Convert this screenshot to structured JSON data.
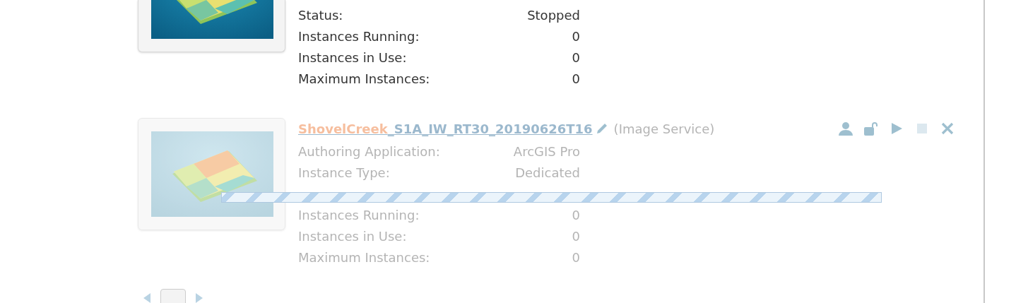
{
  "services": [
    {
      "partial": true,
      "busy": false,
      "details": [
        {
          "kind": "field",
          "label": "Status:",
          "value": "Stopped"
        },
        {
          "kind": "field",
          "label": "Instances Running:",
          "value": "0"
        },
        {
          "kind": "field",
          "label": "Instances in Use:",
          "value": "0"
        },
        {
          "kind": "field",
          "label": "Maximum Instances:",
          "value": "0"
        }
      ]
    },
    {
      "partial": false,
      "busy": true,
      "title": {
        "match": "ShovelCreek",
        "rest": "_S1A_IW_RT30_20190626T16"
      },
      "type": "(Image Service)",
      "actions": [
        {
          "kind": "person",
          "disabled": false
        },
        {
          "kind": "unlock",
          "disabled": false
        },
        {
          "kind": "play",
          "disabled": false
        },
        {
          "kind": "stop",
          "disabled": true
        },
        {
          "kind": "close",
          "disabled": false
        }
      ],
      "details": [
        {
          "kind": "field",
          "label": "Authoring Application:",
          "value": "ArcGIS Pro"
        },
        {
          "kind": "field",
          "label": "Instance Type:",
          "value": "Dedicated"
        },
        {
          "kind": "progress"
        },
        {
          "kind": "field",
          "label": "Instances Running:",
          "value": "0"
        },
        {
          "kind": "field",
          "label": "Instances in Use:",
          "value": "0"
        },
        {
          "kind": "field",
          "label": "Maximum Instances:",
          "value": "0"
        }
      ]
    }
  ]
}
